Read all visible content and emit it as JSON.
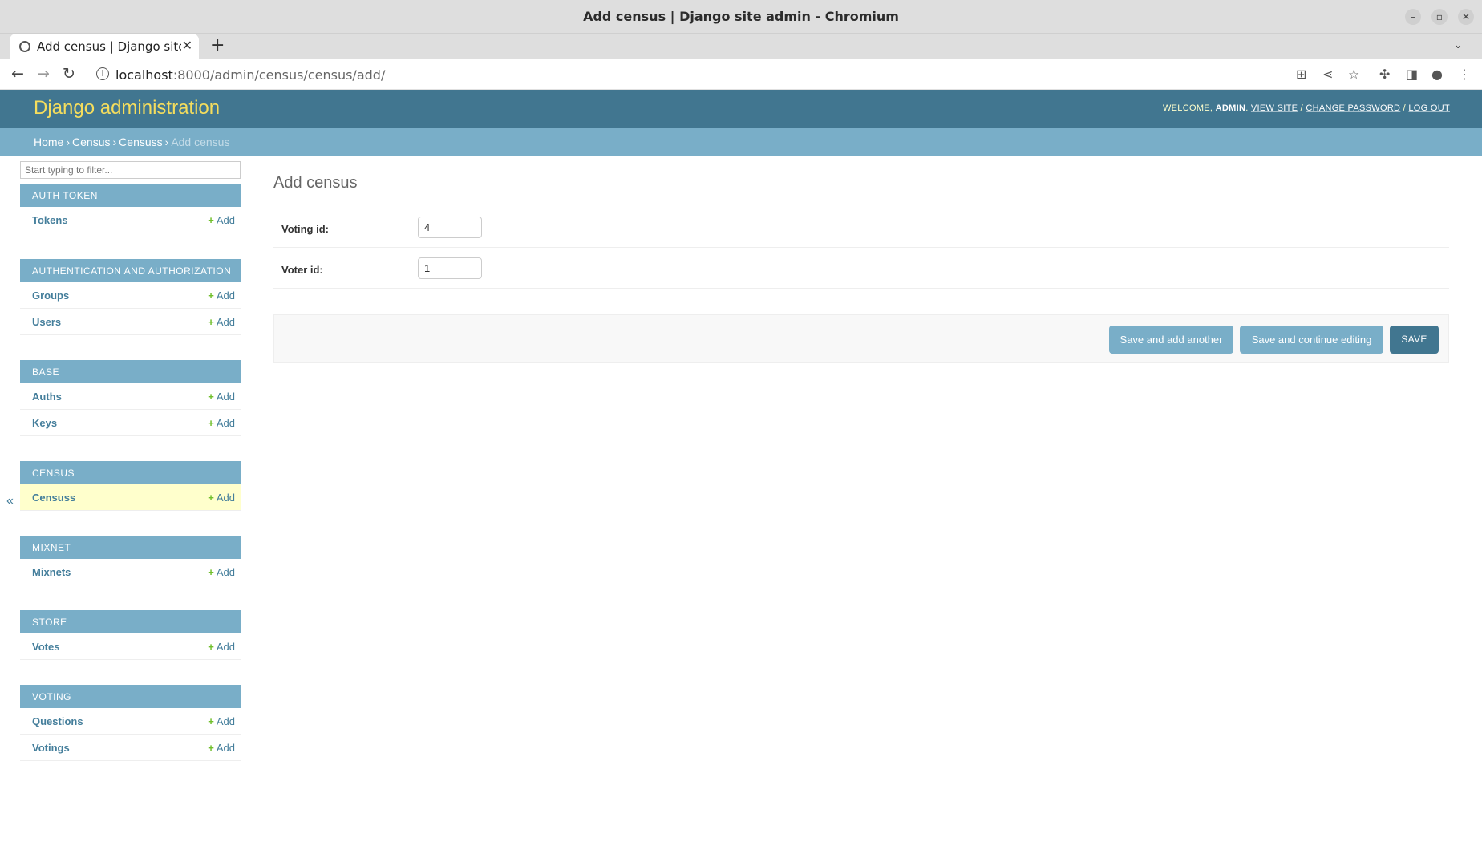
{
  "window": {
    "title": "Add census | Django site admin - Chromium",
    "tab_title": "Add census | Django site admin - Chromium",
    "url_host": "localhost",
    "url_rest": ":8000/admin/census/census/add/"
  },
  "admin": {
    "brand": "Django administration",
    "welcome": "WELCOME,",
    "user": "ADMIN",
    "view_site": "VIEW SITE",
    "change_password": "CHANGE PASSWORD",
    "log_out": "LOG OUT"
  },
  "breadcrumbs": {
    "home": "Home",
    "app": "Census",
    "model": "Censuss",
    "current": "Add census"
  },
  "sidebar": {
    "filter_placeholder": "Start typing to filter...",
    "add_label": "Add",
    "apps": [
      {
        "caption": "AUTH TOKEN",
        "models": [
          "Tokens"
        ]
      },
      {
        "caption": "AUTHENTICATION AND AUTHORIZATION",
        "models": [
          "Groups",
          "Users"
        ]
      },
      {
        "caption": "BASE",
        "models": [
          "Auths",
          "Keys"
        ]
      },
      {
        "caption": "CENSUS",
        "models": [
          "Censuss"
        ]
      },
      {
        "caption": "MIXNET",
        "models": [
          "Mixnets"
        ]
      },
      {
        "caption": "STORE",
        "models": [
          "Votes"
        ]
      },
      {
        "caption": "VOTING",
        "models": [
          "Questions",
          "Votings"
        ]
      }
    ],
    "current_model": "Censuss",
    "collapse_glyph": "«"
  },
  "form": {
    "title": "Add census",
    "fields": [
      {
        "label": "Voting id:",
        "value": "4"
      },
      {
        "label": "Voter id:",
        "value": "1"
      }
    ],
    "buttons": {
      "save_add_another": "Save and add another",
      "save_continue": "Save and continue editing",
      "save": "SAVE"
    }
  },
  "colors": {
    "header": "#417690",
    "breadcrumbs": "#79aec8",
    "brand": "#f5dd5d",
    "link": "#447e9b",
    "add_plus": "#70bf2b",
    "current_row": "#ffffcc"
  }
}
